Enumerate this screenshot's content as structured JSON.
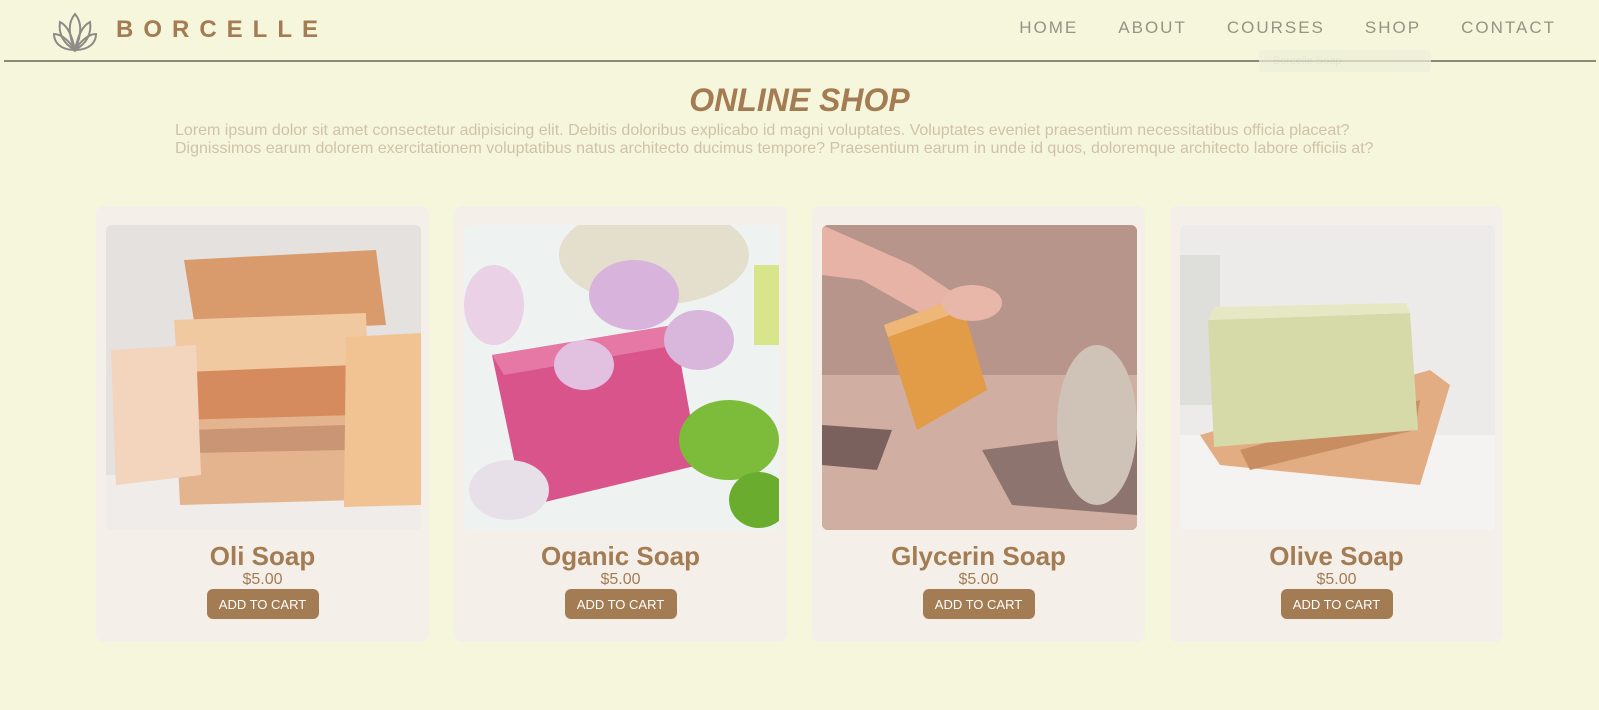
{
  "header": {
    "brand": "BORCELLE",
    "nav": [
      "HOME",
      "ABOUT",
      "COURSES",
      "SHOP",
      "CONTACT"
    ],
    "tooltip": "Borcelle Soap"
  },
  "main": {
    "title": "ONLINE SHOP",
    "intro": "Lorem ipsum dolor sit amet consectetur adipisicing elit. Debitis doloribus explicabo id magni voluptates. Voluptates eveniet praesentium necessitatibus officia placeat? Dignissimos earum dolorem exercitationem voluptatibus natus architecto ducimus tempore? Praesentium earum in unde id quos, doloremque architecto labore officiis at?"
  },
  "products": [
    {
      "name": "Oli Soap",
      "price": "$5.00",
      "button": "ADD TO CART"
    },
    {
      "name": "Oganic Soap",
      "price": "$5.00",
      "button": "ADD TO CART"
    },
    {
      "name": "Glycerin Soap",
      "price": "$5.00",
      "button": "ADD TO CART"
    },
    {
      "name": "Olive Soap",
      "price": "$5.00",
      "button": "ADD TO CART"
    }
  ],
  "colors": {
    "background": "#f6f6dc",
    "accent": "#a37c53",
    "card": "#f4efe8"
  }
}
